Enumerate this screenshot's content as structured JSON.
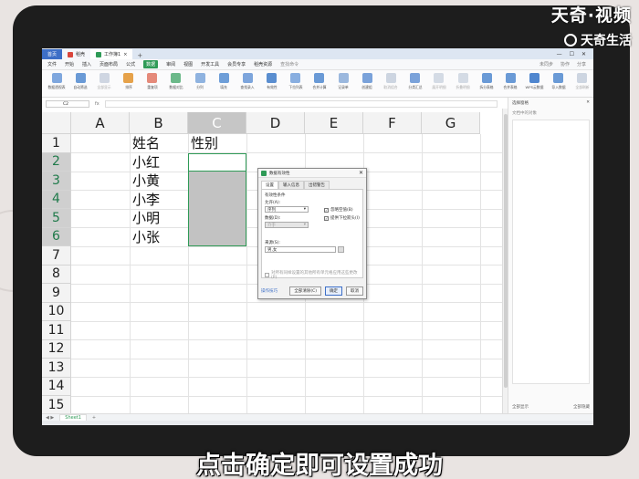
{
  "watermark": {
    "brand": "天奇·视频",
    "sub": "天奇生活"
  },
  "caption": "点击确定即可设置成功",
  "titlebar": {
    "tabs": [
      {
        "label": "首页"
      },
      {
        "label": "稻壳"
      },
      {
        "label": "工作簿1"
      }
    ]
  },
  "menu": {
    "items": [
      "文件",
      "开始",
      "插入",
      "页面布局",
      "公式",
      "数据",
      "审阅",
      "视图",
      "开发工具",
      "会员专享",
      "稻壳资源"
    ],
    "active": "数据",
    "search": "查找命令",
    "right": [
      "未同步",
      "协作",
      "分享"
    ]
  },
  "ribbon": {
    "buttons": [
      "数据透视表",
      "自动筛选",
      "全部显示",
      "排序",
      "重复项",
      "数据对比",
      "分列",
      "填充",
      "查找录入",
      "有效性",
      "下拉列表",
      "合并计算",
      "记录单",
      "创建组",
      "取消组合",
      "分类汇总",
      "展开明细",
      "折叠明细",
      "拆分表格",
      "合并表格",
      "WPS云数据",
      "导入数据",
      "全部刷新"
    ]
  },
  "formula": {
    "cell_ref": "C2",
    "fx": "fx",
    "value": ""
  },
  "grid": {
    "columns": [
      "A",
      "B",
      "C",
      "D",
      "E",
      "F",
      "G"
    ],
    "rows": [
      "1",
      "2",
      "3",
      "4",
      "5",
      "6",
      "7",
      "8",
      "9",
      "10",
      "11",
      "12",
      "13",
      "14",
      "15"
    ],
    "cells": {
      "B1": "姓名",
      "C1": "性别",
      "B2": "小红",
      "B3": "小黄",
      "B4": "小李",
      "B5": "小明",
      "B6": "小张"
    },
    "selected_column": "C",
    "selected_range": "C2:C6"
  },
  "sidepane": {
    "title": "选择窗格",
    "subtitle": "文档中的对象",
    "footer_left": "全部显示",
    "footer_right": "全部隐藏"
  },
  "sheet": {
    "tab": "Sheet1"
  },
  "dialog": {
    "title": "数据有效性",
    "tabs": [
      "设置",
      "输入信息",
      "出错警告"
    ],
    "active_tab": "设置",
    "section": "有效性条件",
    "allow_label": "允许(A):",
    "allow_value": "序列",
    "data_label": "数据(D):",
    "data_value": "介于",
    "ignore_blank": "忽略空值(B)",
    "dropdown": "提供下拉箭头(I)",
    "source_label": "来源(S):",
    "source_value": "男,女",
    "apply_all": "对所有同样设置的其他所有单元格应用这些更改(P)",
    "tip": "操作技巧",
    "clear_all": "全部清除(C)",
    "ok": "确定",
    "cancel": "取消"
  }
}
